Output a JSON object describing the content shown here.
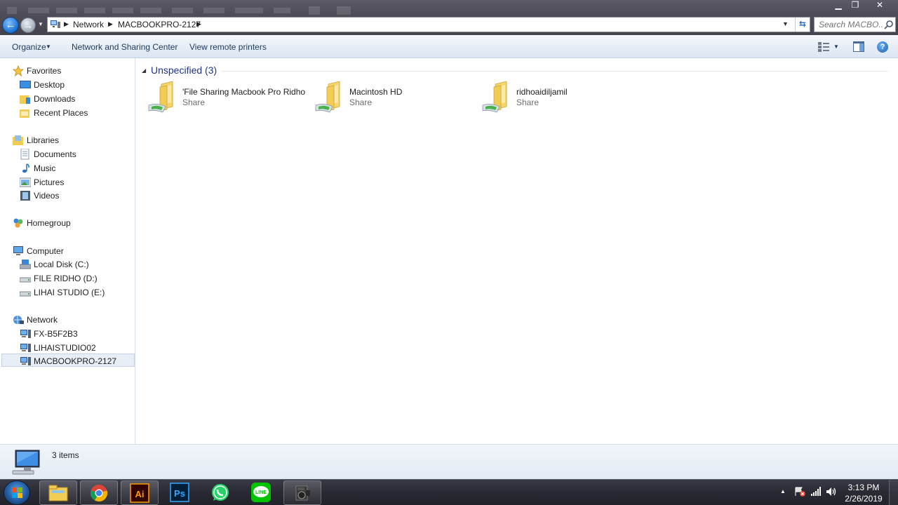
{
  "window": {
    "minimize_glyph": "▁",
    "maximize_glyph": "❐",
    "close_glyph": "✕"
  },
  "address_bar": {
    "crumbs": [
      "Network",
      "MACBOOKPRO-2127"
    ]
  },
  "search": {
    "placeholder": "Search MACBO..."
  },
  "toolbar": {
    "organize": "Organize",
    "network_sharing_center": "Network and Sharing Center",
    "view_remote_printers": "View remote printers"
  },
  "nav_pane": {
    "favorites": {
      "label": "Favorites",
      "items": [
        "Desktop",
        "Downloads",
        "Recent Places"
      ]
    },
    "libraries": {
      "label": "Libraries",
      "items": [
        "Documents",
        "Music",
        "Pictures",
        "Videos"
      ]
    },
    "homegroup": {
      "label": "Homegroup"
    },
    "computer": {
      "label": "Computer",
      "items": [
        "Local Disk (C:)",
        "FILE RIDHO (D:)",
        "LIHAI STUDIO (E:)"
      ]
    },
    "network": {
      "label": "Network",
      "items": [
        "FX-B5F2B3",
        "LIHAISTUDIO02",
        "MACBOOKPRO-2127"
      ]
    },
    "selected": "MACBOOKPRO-2127"
  },
  "content": {
    "group_header": "Unspecified (3)",
    "shares": [
      {
        "name": "'File Sharing Macbook Pro Ridho",
        "type": "Share"
      },
      {
        "name": "Macintosh HD",
        "type": "Share"
      },
      {
        "name": "ridhoaidiljamil",
        "type": "Share"
      }
    ]
  },
  "details": {
    "item_count": "3 items"
  },
  "taskbar": {
    "apps": [
      "windows-explorer",
      "chrome",
      "illustrator",
      "photoshop",
      "whatsapp",
      "line",
      "video-app"
    ],
    "illustrator_text": "Ai",
    "photoshop_text": "Ps",
    "line_text": "LINE",
    "time": "3:13 PM",
    "date": "2/26/2019"
  },
  "colors": {
    "accent": "#1e3287",
    "folder": "#f2cd55",
    "titlebar": "#4e4d58",
    "taskbar": "#2a2a34"
  }
}
